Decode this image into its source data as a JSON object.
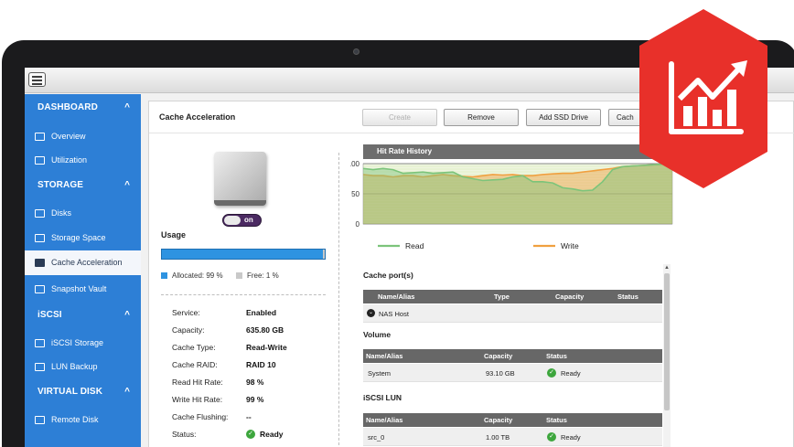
{
  "sidebar": {
    "sections": [
      {
        "title": "DASHBOARD",
        "items": [
          "Overview",
          "Utilization"
        ]
      },
      {
        "title": "STORAGE",
        "items": [
          "Disks",
          "Storage Space",
          "Cache Acceleration",
          "Snapshot Vault"
        ]
      },
      {
        "title": "iSCSI",
        "items": [
          "iSCSI Storage",
          "LUN Backup"
        ]
      },
      {
        "title": "VIRTUAL DISK",
        "items": [
          "Remote Disk"
        ]
      }
    ],
    "active_item": "Cache Acceleration",
    "chevron": "^"
  },
  "panel": {
    "title": "Cache Acceleration",
    "buttons": {
      "create": "Create",
      "remove": "Remove",
      "add_ssd": "Add SSD Drive",
      "cache": "Cach"
    }
  },
  "cache": {
    "toggle": "on",
    "usage_label": "Usage",
    "usage_allocated_fraction": 0.99,
    "allocated_label": "Allocated: 99 %",
    "free_label": "Free: 1 %",
    "info": [
      {
        "key": "Service:",
        "value": "Enabled"
      },
      {
        "key": "Capacity:",
        "value": "635.80 GB"
      },
      {
        "key": "Cache Type:",
        "value": "Read-Write"
      },
      {
        "key": "Cache RAID:",
        "value": "RAID 10"
      },
      {
        "key": "Read Hit Rate:",
        "value": "98 %"
      },
      {
        "key": "Write Hit Rate:",
        "value": "99 %"
      },
      {
        "key": "Cache Flushing:",
        "value": "--"
      },
      {
        "key": "Status:",
        "value": "Ready"
      }
    ]
  },
  "chart_data": {
    "type": "area",
    "title": "Hit Rate History",
    "yticks": [
      "100",
      "50",
      "0"
    ],
    "ylim": [
      0,
      100
    ],
    "legend": [
      "Read",
      "Write"
    ],
    "colors": {
      "read": "#7cc47a",
      "write": "#f0a040",
      "grid": "#b5d86b"
    },
    "series": [
      {
        "name": "Read",
        "values": [
          92,
          90,
          92,
          90,
          84,
          85,
          86,
          84,
          85,
          86,
          78,
          75,
          72,
          73,
          74,
          78,
          80,
          70,
          70,
          68,
          60,
          58,
          55,
          56,
          70,
          90,
          95,
          96,
          97,
          98,
          99,
          99
        ]
      },
      {
        "name": "Write",
        "values": [
          82,
          80,
          80,
          78,
          80,
          80,
          78,
          80,
          82,
          80,
          79,
          78,
          80,
          82,
          81,
          82,
          80,
          80,
          82,
          83,
          84,
          84,
          86,
          88,
          90,
          92,
          95,
          96,
          97,
          98,
          99,
          99
        ]
      }
    ]
  },
  "ports": {
    "title": "Cache port(s)",
    "columns": [
      "Name/Alias",
      "Type",
      "Capacity",
      "Status"
    ],
    "rows": [
      [
        "NAS Host",
        "",
        "",
        ""
      ]
    ]
  },
  "volume": {
    "title": "Volume",
    "columns": [
      "Name/Alias",
      "Capacity",
      "Status"
    ],
    "rows": [
      [
        "System",
        "93.10 GB",
        "Ready"
      ]
    ]
  },
  "iscsi_lun": {
    "title": "iSCSI LUN",
    "columns": [
      "Name/Alias",
      "Capacity",
      "Status"
    ],
    "rows": [
      [
        "src_0",
        "1.00 TB",
        "Ready"
      ]
    ]
  },
  "logo": {
    "name": "chart-logo",
    "color": "#e8302a"
  }
}
